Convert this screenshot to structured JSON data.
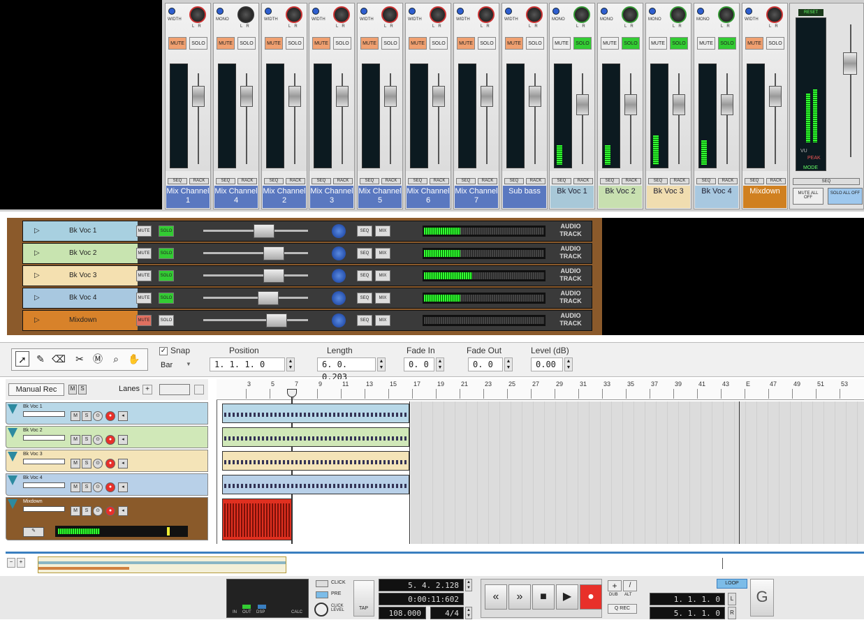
{
  "mixer": {
    "strips": [
      {
        "name": "Mix Channel 1",
        "color": "#5a78c0",
        "mono_label": "WIDTH",
        "mute": "MUTE",
        "solo": "SOLO",
        "mute_on": true,
        "solo_on": false,
        "level": 0.0
      },
      {
        "name": "Mix Channel 4",
        "color": "#5a78c0",
        "mono_label": "MONO",
        "mute": "MUTE",
        "solo": "SOLO",
        "mute_on": true,
        "solo_on": false,
        "level": 0.0
      },
      {
        "name": "Mix Channel 2",
        "color": "#5a78c0",
        "mono_label": "WIDTH",
        "mute": "MUTE",
        "solo": "SOLO",
        "mute_on": true,
        "solo_on": false,
        "level": 0.0
      },
      {
        "name": "Mix Channel 3",
        "color": "#5a78c0",
        "mono_label": "WIDTH",
        "mute": "MUTE",
        "solo": "SOLO",
        "mute_on": true,
        "solo_on": false,
        "level": 0.0
      },
      {
        "name": "Mix Channel 5",
        "color": "#5a78c0",
        "mono_label": "WIDTH",
        "mute": "MUTE",
        "solo": "SOLO",
        "mute_on": true,
        "solo_on": false,
        "level": 0.0
      },
      {
        "name": "Mix Channel 6",
        "color": "#5a78c0",
        "mono_label": "WIDTH",
        "mute": "MUTE",
        "solo": "SOLO",
        "mute_on": true,
        "solo_on": false,
        "level": 0.0
      },
      {
        "name": "Mix Channel 7",
        "color": "#5a78c0",
        "mono_label": "WIDTH",
        "mute": "MUTE",
        "solo": "SOLO",
        "mute_on": true,
        "solo_on": false,
        "level": 0.0
      },
      {
        "name": "Sub bass",
        "color": "#5a78c0",
        "mono_label": "WIDTH",
        "mute": "MUTE",
        "solo": "SOLO",
        "mute_on": true,
        "solo_on": false,
        "level": 0.0
      },
      {
        "name": "Bk Voc 1",
        "color": "#a8c8d8",
        "mono_label": "MONO",
        "mute": "MUTE",
        "solo": "SOLO",
        "mute_on": false,
        "solo_on": true,
        "level": 0.2
      },
      {
        "name": "Bk Voc 2",
        "color": "#c8e0b0",
        "mono_label": "MONO",
        "mute": "MUTE",
        "solo": "SOLO",
        "mute_on": false,
        "solo_on": true,
        "level": 0.2
      },
      {
        "name": "Bk Voc 3",
        "color": "#f0ddb0",
        "mono_label": "MONO",
        "mute": "MUTE",
        "solo": "SOLO",
        "mute_on": false,
        "solo_on": true,
        "level": 0.3
      },
      {
        "name": "Bk Voc 4",
        "color": "#a8c8e0",
        "mono_label": "MONO",
        "mute": "MUTE",
        "solo": "SOLO",
        "mute_on": false,
        "solo_on": true,
        "level": 0.25
      },
      {
        "name": "Mixdown",
        "color": "#d08020",
        "mono_label": "WIDTH",
        "mute": "MUTE",
        "solo": "SOLO",
        "mute_on": true,
        "solo_on": false,
        "level": 0.0
      }
    ],
    "seq_label": "SEQ",
    "rack_label": "RACK",
    "master": {
      "reset": "RESET",
      "seq": "SEQ",
      "mute_all": "MUTE ALL OFF",
      "solo_all": "SOLO ALL OFF",
      "vu": "VU",
      "peak": "PEAK",
      "mode": "MODE"
    }
  },
  "rack": {
    "tracks": [
      {
        "name": "Bk Voc 1",
        "color": "#a8d0e0",
        "mute": "MUTE",
        "solo": "SOLO",
        "solo_on": true,
        "mute_red": false,
        "meter": 0.3
      },
      {
        "name": "Bk Voc 2",
        "color": "#c8e4b0",
        "mute": "MUTE",
        "solo": "SOLO",
        "solo_on": true,
        "mute_red": false,
        "meter": 0.3
      },
      {
        "name": "Bk Voc 3",
        "color": "#f4e0b0",
        "mute": "MUTE",
        "solo": "SOLO",
        "solo_on": true,
        "mute_red": false,
        "meter": 0.4
      },
      {
        "name": "Bk Voc 4",
        "color": "#a8c8e0",
        "mute": "MUTE",
        "solo": "SOLO",
        "solo_on": true,
        "mute_red": false,
        "meter": 0.3
      },
      {
        "name": "Mixdown",
        "color": "#d8822a",
        "mute": "MUTE",
        "solo": "SOLO",
        "solo_on": false,
        "mute_red": true,
        "meter": 0.0
      }
    ],
    "seq_label": "SEQ",
    "mix_label": "MIX",
    "audio_track_label": "AUDIO TRACK"
  },
  "toolbar": {
    "snap_label": "Snap",
    "snap_value": "Bar",
    "position_label": "Position",
    "position_value": "1. 1. 1.   0",
    "length_label": "Length",
    "length_value": "6. 0. 0.203",
    "fadein_label": "Fade In",
    "fadein_value": "0.   0",
    "fadeout_label": "Fade Out",
    "fadeout_value": "0.   0",
    "level_label": "Level (dB)",
    "level_value": "0.00"
  },
  "sequencer": {
    "manual_rec": "Manual Rec",
    "lanes_label": "Lanes",
    "ruler_ticks": [
      "3",
      "5",
      "7",
      "9",
      "11",
      "13",
      "15",
      "17",
      "19",
      "21",
      "23",
      "25",
      "27",
      "29",
      "31",
      "33",
      "35",
      "37",
      "39",
      "41",
      "43",
      "E",
      "47",
      "49",
      "51",
      "53"
    ],
    "lanes": [
      {
        "title": "Bk Voc 1",
        "color": "#b8d8e8"
      },
      {
        "title": "Bk Voc 2",
        "color": "#d0e8b8"
      },
      {
        "title": "Bk Voc 3",
        "color": "#f4e4b8"
      },
      {
        "title": "Bk Voc 4",
        "color": "#b8d0e8"
      },
      {
        "title": "Mixdown",
        "color": "#8a5a2a"
      }
    ]
  },
  "transport": {
    "click_label": "CLICK",
    "pre_label": "PRE",
    "click_level_label": "CLICK LEVEL",
    "tap_label": "TAP",
    "in_label": "IN",
    "out_label": "OUT",
    "dsp_label": "DSP",
    "calc_label": "CALC",
    "position": "5. 4. 2.128",
    "time": "0:00:11:602",
    "tempo": "108.000",
    "signature": "4/4",
    "dub_label": "DUB",
    "alt_label": "ALT",
    "qrec_label": "Q REC",
    "loop_label": "LOOP",
    "loop_left": "1. 1. 1.   0",
    "loop_right": "5. 1. 1.   0",
    "l_label": "L",
    "r_label": "R",
    "rewind": "«",
    "forward": "»",
    "stop": "■",
    "play": "▶",
    "record": "●"
  }
}
